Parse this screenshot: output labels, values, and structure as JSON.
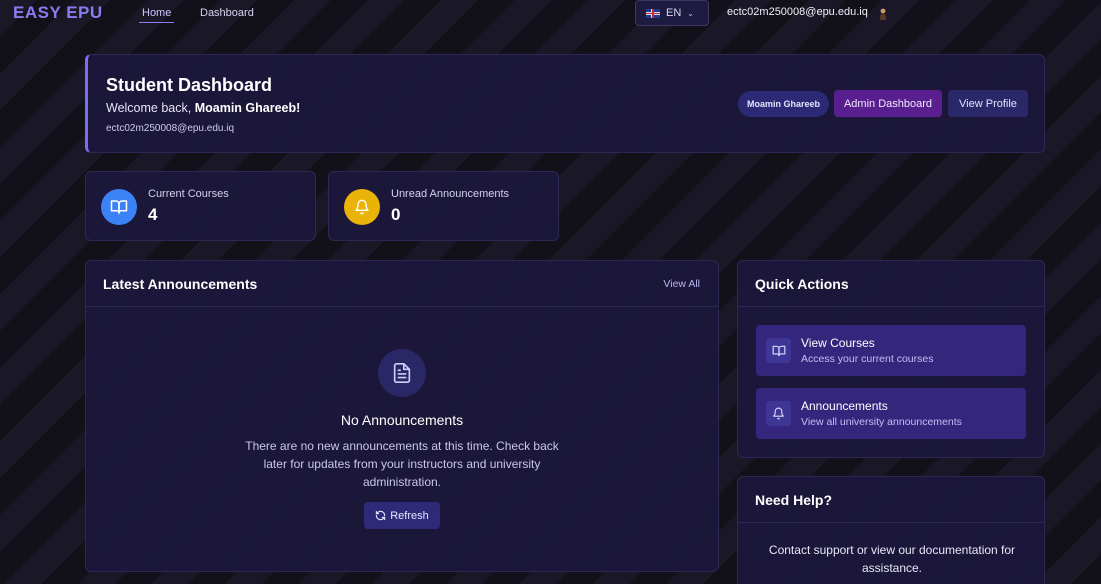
{
  "nav": {
    "logo": "EASY EPU",
    "links": [
      "Home",
      "Dashboard"
    ],
    "language": "EN",
    "user_email": "ectc02m250008@epu.edu.iq"
  },
  "header": {
    "title": "Student Dashboard",
    "welcome_prefix": "Welcome back, ",
    "user_name": "Moamin Ghareeb!",
    "email": "ectc02m250008@epu.edu.iq",
    "name_pill": "Moamin Ghareeb",
    "admin_button": "Admin Dashboard",
    "profile_button": "View Profile"
  },
  "stats": [
    {
      "label": "Current Courses",
      "value": "4",
      "icon": "book-icon",
      "color": "#3b82f6"
    },
    {
      "label": "Unread Announcements",
      "value": "0",
      "icon": "bell-icon",
      "color": "#eab308"
    }
  ],
  "announcements": {
    "title": "Latest Announcements",
    "view_all": "View All",
    "empty_title": "No Announcements",
    "empty_text": "There are no new announcements at this time. Check back later for updates from your instructors and university administration.",
    "refresh": "Refresh"
  },
  "quick_actions": {
    "title": "Quick Actions",
    "items": [
      {
        "title": "View Courses",
        "subtitle": "Access your current courses",
        "icon": "book-icon"
      },
      {
        "title": "Announcements",
        "subtitle": "View all university announcements",
        "icon": "bell-icon"
      }
    ]
  },
  "help": {
    "title": "Need Help?",
    "text": "Contact support or view our documentation for assistance."
  }
}
